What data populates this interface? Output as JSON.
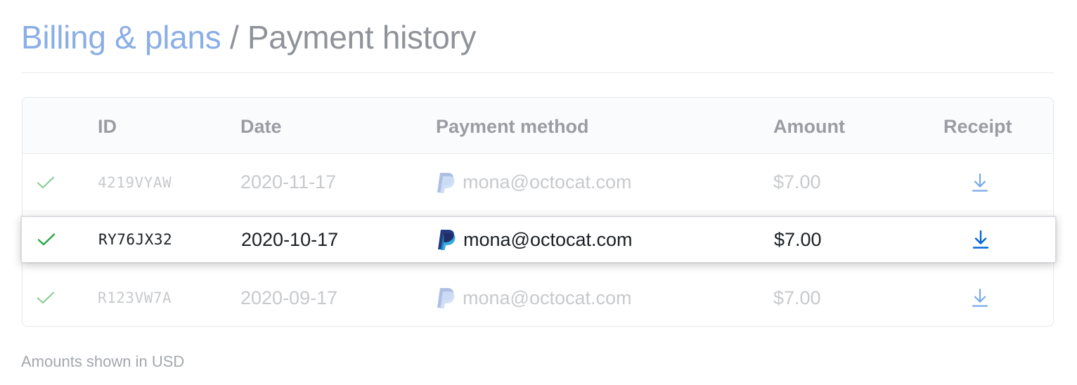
{
  "breadcrumb": {
    "parent": "Billing & plans",
    "separator": "/",
    "current": "Payment history"
  },
  "table": {
    "columns": {
      "id": "ID",
      "date": "Date",
      "method": "Payment method",
      "amount": "Amount",
      "receipt": "Receipt"
    },
    "rows": [
      {
        "status_icon": "check-icon",
        "id": "4219VYAW",
        "date": "2020-11-17",
        "method_icon": "paypal-icon",
        "method": "mona@octocat.com",
        "amount": "$7.00",
        "receipt_icon": "download-icon"
      },
      {
        "status_icon": "check-icon",
        "id": "RY76JX32",
        "date": "2020-10-17",
        "method_icon": "paypal-icon",
        "method": "mona@octocat.com",
        "amount": "$7.00",
        "receipt_icon": "download-icon",
        "highlighted": true
      },
      {
        "status_icon": "check-icon",
        "id": "R123VW7A",
        "date": "2020-09-17",
        "method_icon": "paypal-icon",
        "method": "mona@octocat.com",
        "amount": "$7.00",
        "receipt_icon": "download-icon"
      }
    ]
  },
  "footnote": "Amounts shown in USD",
  "colors": {
    "link": "#8aaee6",
    "success": "#28a745",
    "download": "#0366d6",
    "paypal_dark": "#253b80",
    "paypal_light": "#179bd7"
  }
}
